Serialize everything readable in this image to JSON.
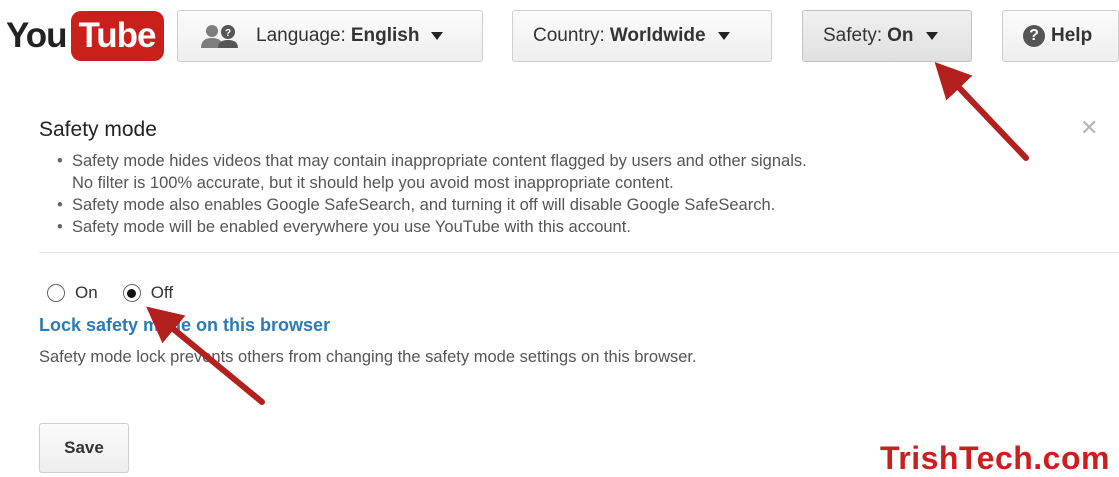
{
  "logo": {
    "you": "You",
    "tube": "Tube"
  },
  "header": {
    "language": {
      "label": "Language:",
      "value": "English"
    },
    "country": {
      "label": "Country:",
      "value": "Worldwide"
    },
    "safety": {
      "label": "Safety:",
      "value": "On"
    },
    "help": {
      "icon_glyph": "?",
      "label": "Help"
    }
  },
  "panel": {
    "title": "Safety mode",
    "close_glyph": "✕",
    "bullets": [
      "Safety mode hides videos that may contain inappropriate content flagged by users and other signals.",
      "No filter is 100% accurate, but it should help you avoid most inappropriate content.",
      "Safety mode also enables Google SafeSearch, and turning it off will disable Google SafeSearch.",
      "Safety mode will be enabled everywhere you use YouTube with this account."
    ],
    "radio": {
      "on_label": "On",
      "off_label": "Off",
      "selected": "Off"
    },
    "lock_link": "Lock safety mode on this browser",
    "lock_description": "Safety mode lock prevents others from changing the safety mode settings on this browser.",
    "save_label": "Save"
  },
  "watermark": "TrishTech.com",
  "colors": {
    "brand_red": "#c9201c",
    "link_blue": "#2a7bb8",
    "arrow_red": "#b3201e"
  },
  "icons": [
    "people-icon",
    "caret-down-icon",
    "help-icon",
    "close-icon",
    "radio-button"
  ]
}
